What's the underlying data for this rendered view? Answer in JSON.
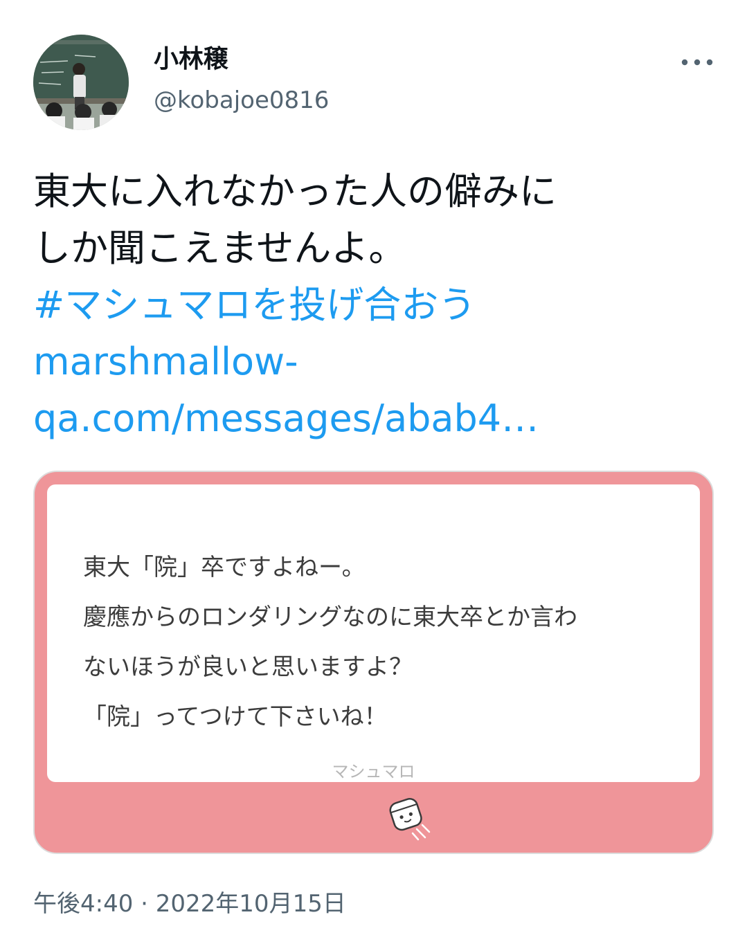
{
  "author": {
    "display_name": "小林穣",
    "handle": "@kobajoe0816",
    "avatar_icon": "classroom-photo-avatar"
  },
  "actions": {
    "more_icon": "more-horizontal-icon"
  },
  "tweet": {
    "text_lines": [
      "東大に入れなかった人の僻みに",
      "しか聞こえませんよ。"
    ],
    "hashtag": "#マシュマロを投げ合おう",
    "link_lines": [
      "marshmallow-",
      "qa.com/messages/abab4…"
    ]
  },
  "card": {
    "message_lines": [
      "東大「院」卒ですよねー。",
      "慶應からのロンダリングなのに東大卒とか言わ",
      "ないほうが良いと思いますよ？",
      "「院」ってつけて下さいね！"
    ],
    "brand": "マシュマロ",
    "brand_icon": "marshmallow-mascot-icon",
    "background_color": "#ef9599"
  },
  "meta": {
    "timestamp": "午後4:40 · 2022年10月15日"
  },
  "colors": {
    "link": "#1d9bf0",
    "secondary_text": "#536471",
    "primary_text": "#0f1419"
  }
}
